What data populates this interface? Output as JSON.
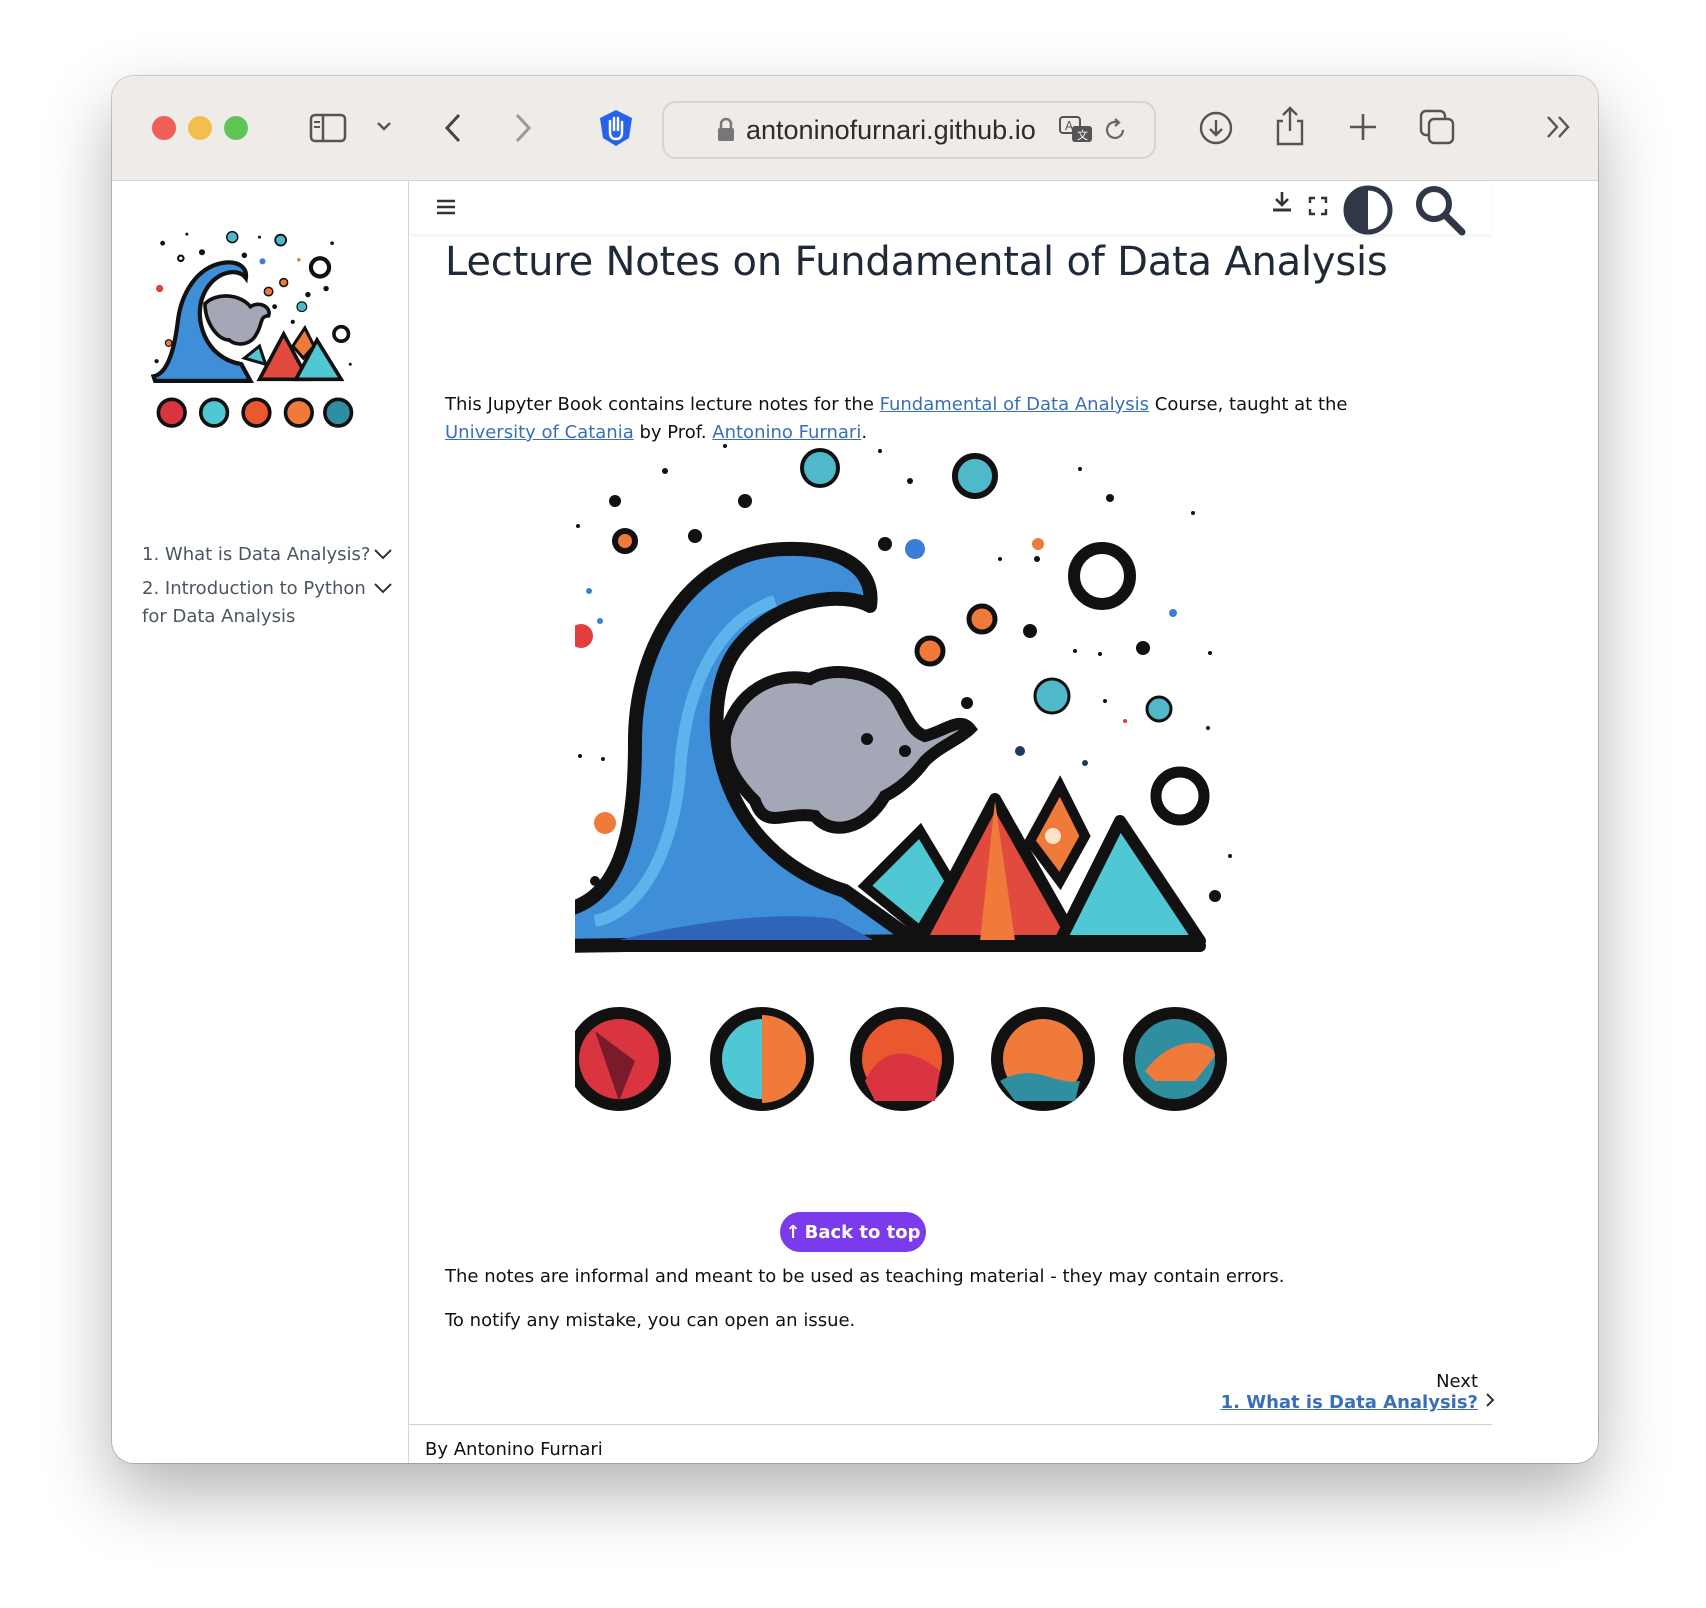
{
  "browser": {
    "url": "antoninofurnari.github.io",
    "traffic_lights": {
      "close": "#ec5f57",
      "minimize": "#f4be4f",
      "zoom": "#5fc454"
    },
    "icons": [
      "sidebar-icon",
      "chevron-down-icon",
      "back-icon",
      "forward-icon",
      "hand-shield-icon",
      "lock-icon",
      "translate-icon",
      "reload-icon",
      "download-icon",
      "share-icon",
      "new-tab-icon",
      "tab-overview-icon",
      "more-icon"
    ]
  },
  "sidebar": {
    "items": [
      {
        "label": "1. What is Data Analysis?"
      },
      {
        "label": "2. Introduction to Python for Data Analysis"
      }
    ]
  },
  "header": {
    "icons": [
      "menu-icon",
      "download-icon",
      "fullscreen-icon",
      "theme-toggle-icon",
      "search-icon"
    ]
  },
  "content": {
    "title": "Lecture Notes on Fundamental of Data Analysis",
    "intro": {
      "t1": "This Jupyter Book contains lecture notes for the ",
      "link1": "Fundamental of Data Analysis",
      "t2": " Course, taught at the ",
      "link2": "University of Catania",
      "t3": " by Prof. ",
      "link3": "Antonino Furnari",
      "t4": "."
    },
    "note1": "The notes are informal and meant to be used as teaching material - they may contain errors.",
    "note2": "To notify any mistake, you can open an issue.",
    "back_to_top": "Back to top",
    "next_label": "Next",
    "next_link": "1. What is Data Analysis?",
    "footer": "By Antonino Furnari"
  },
  "colors": {
    "accent_purple": "#7c3aed",
    "link_blue": "#3b6fb5"
  }
}
